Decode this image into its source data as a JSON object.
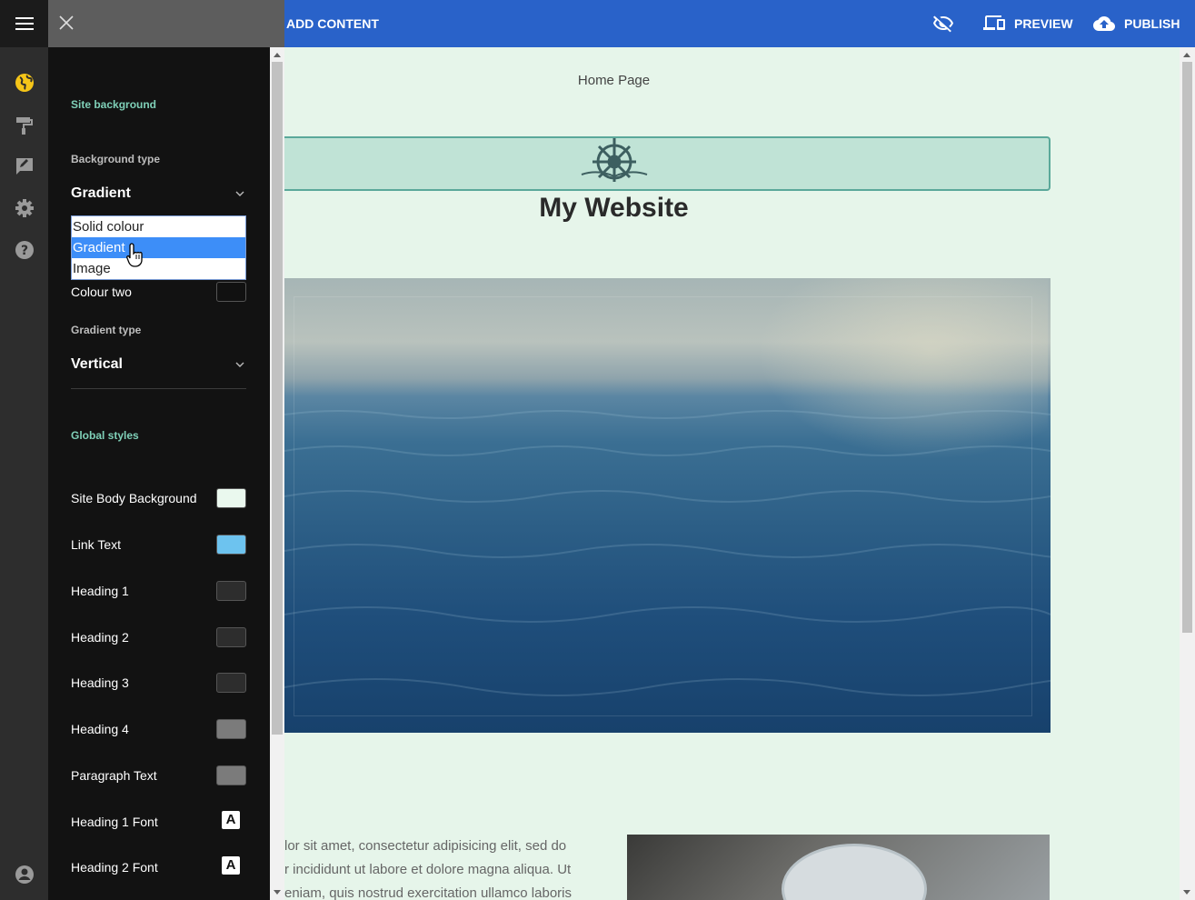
{
  "topbar": {
    "add_content": "ADD CONTENT",
    "preview": "PREVIEW",
    "publish": "PUBLISH",
    "color": "#2962c9"
  },
  "panel": {
    "site_background": "Site background",
    "background_type_label": "Background type",
    "background_type_value": "Gradient",
    "dropdown_options": [
      "Solid colour",
      "Gradient",
      "Image"
    ],
    "colour_two": "Colour two",
    "gradient_type_label": "Gradient type",
    "gradient_type_value": "Vertical",
    "global_styles": "Global styles",
    "styles": [
      {
        "label": "Site Body Background",
        "color": "#eaf8ee"
      },
      {
        "label": "Link Text",
        "color": "#6dc3ef"
      },
      {
        "label": "Heading 1",
        "color": "#2d2d2d"
      },
      {
        "label": "Heading 2",
        "color": "#2d2d2d"
      },
      {
        "label": "Heading 3",
        "color": "#2d2d2d"
      },
      {
        "label": "Heading 4",
        "color": "#7b7b7b"
      },
      {
        "label": "Paragraph Text",
        "color": "#7b7b7b"
      },
      {
        "label": "Heading 1 Font",
        "icon": "font-icon"
      },
      {
        "label": "Heading 2 Font",
        "icon": "font-icon"
      }
    ]
  },
  "page": {
    "home_link": "Home Page",
    "site_title": "My Website",
    "para_lines": [
      "lor sit amet, consectetur adipisicing elit, sed do",
      "r incididunt ut labore et dolore magna aliqua. Ut",
      "eniam, quis nostrud exercitation ullamco laboris"
    ]
  }
}
